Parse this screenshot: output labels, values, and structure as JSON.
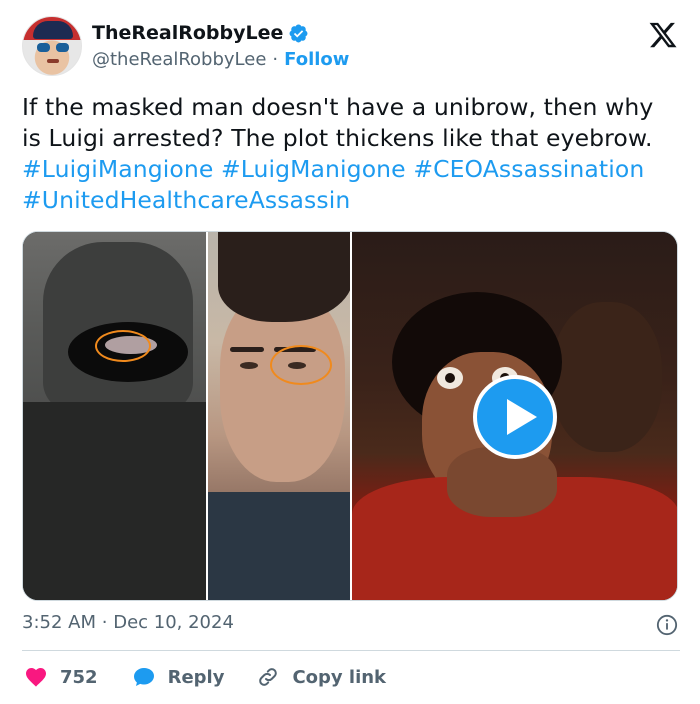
{
  "user": {
    "display_name": "TheRealRobbyLee",
    "handle": "@theRealRobbyLee",
    "separator": "·",
    "follow_label": "Follow",
    "verified_color": "#1d9bf0"
  },
  "tweet": {
    "text_part1": "If the masked man doesn't have a unibrow, then why is Luigi arrested? The plot thickens like that eyebrow.",
    "hashtags": [
      "#LuigiMangione",
      "#LuigManigone",
      "#CEOAssassination",
      "#UnitedHealthcareAssassin"
    ]
  },
  "media": {
    "type": "video",
    "play_icon": "play-icon",
    "annotation_color": "#f08a1d"
  },
  "meta": {
    "time": "3:52 AM",
    "separator": "·",
    "date": "Dec 10, 2024"
  },
  "actions": {
    "like_count": "752",
    "reply_label": "Reply",
    "copy_label": "Copy link"
  },
  "icons": [
    "verified-badge-icon",
    "x-logo-icon",
    "info-icon",
    "heart-icon",
    "reply-bubble-icon",
    "link-icon"
  ],
  "colors": {
    "accent": "#1d9bf0",
    "like": "#f91880",
    "text": "#0f1419",
    "muted": "#536471"
  }
}
